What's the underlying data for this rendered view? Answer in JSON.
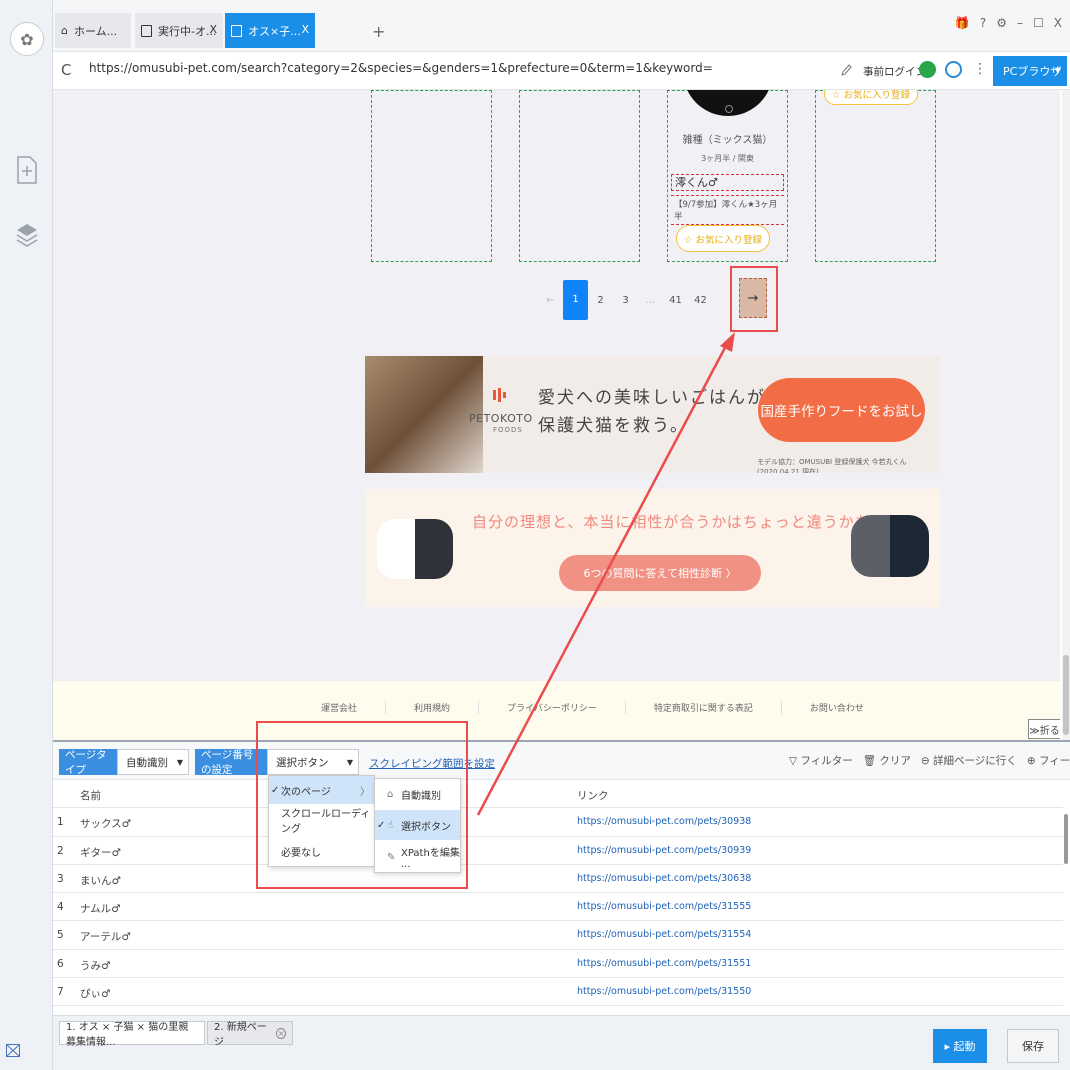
{
  "tabs": [
    {
      "label": "ホーム..."
    },
    {
      "label": "実行中-オ...",
      "close": "X"
    },
    {
      "label": "オス×子...",
      "close": "X"
    }
  ],
  "tab_add": "+",
  "window_controls": [
    "🎁",
    "?",
    "⚙",
    "–",
    "☐",
    "X"
  ],
  "address": {
    "reload": "C",
    "url": "https://omusubi-pet.com/search?category=2&species=&genders=1&prefecture=0&term=1&keyword=",
    "pre_login": "事前ログイン",
    "kebab": "⋮",
    "pc_browser": "PCブラウザ",
    "pc_caret": "▼"
  },
  "page": {
    "card": {
      "breed": "雑種（ミックス猫）",
      "age": "3ヶ月半 / 関東",
      "name": "澪くん♂",
      "note": "【9/7参加】澪くん★3ヶ月半",
      "fav": "☆ お気に入り登録"
    },
    "fav_partial": "☆ お気に入り登録",
    "pager": [
      "←",
      "1",
      "2",
      "3",
      "…",
      "41",
      "42"
    ],
    "pager_next": "→",
    "banner1": {
      "logo": "PETOKOTO",
      "logo_sub": "FOODS",
      "copy_line1": "愛犬への美味しいごはんが",
      "copy_line2": "保護犬猫を救う。",
      "cta": "国産手作りフードをお試し",
      "credit": "モデル協力：OMUSUBI 登録保護犬 今若丸くん (2020.04.21 現在)"
    },
    "banner2": {
      "title": "自分の理想と、本当に相性が合うかはちょっと違うかも。",
      "cta": "6つの質問に答えて相性診断 〉"
    },
    "footer_links": [
      "運営会社",
      "利用規約",
      "プライバシーポリシー",
      "特定商取引に関する表記",
      "お問い合わせ"
    ],
    "collapse": "≫折る"
  },
  "panel": {
    "page_type_label": "ページタイプ",
    "page_type_value": "自動識別",
    "page_num_label": "ページ番号の設定",
    "page_num_value": "選択ボタン",
    "scrape_range": "スクレイピング範囲を設定",
    "tools": [
      "▽ フィルター",
      "🗑 クリア",
      "⊖ 詳細ページに行く",
      "⊕ フィールドを追加"
    ],
    "columns": [
      "名前",
      "リンク"
    ],
    "rows": [
      {
        "idx": "1",
        "name": "サックス♂",
        "link": "https://omusubi-pet.com/pets/30938"
      },
      {
        "idx": "2",
        "name": "ギター♂",
        "link": "https://omusubi-pet.com/pets/30939"
      },
      {
        "idx": "3",
        "name": "まいん♂",
        "link": "https://omusubi-pet.com/pets/30638"
      },
      {
        "idx": "4",
        "name": "ナムル♂",
        "link": "https://omusubi-pet.com/pets/31555"
      },
      {
        "idx": "5",
        "name": "アーテル♂",
        "link": "https://omusubi-pet.com/pets/31554"
      },
      {
        "idx": "6",
        "name": "うみ♂",
        "link": "https://omusubi-pet.com/pets/31551"
      },
      {
        "idx": "7",
        "name": "ぴぃ♂",
        "link": "https://omusubi-pet.com/pets/31550"
      }
    ],
    "menu1": [
      {
        "label": "次のページ",
        "check": "✓",
        "sub": "〉"
      },
      {
        "label": "スクロールローディング"
      },
      {
        "label": "必要なし"
      }
    ],
    "menu2": [
      {
        "label": "自動識別",
        "icon": "⌂"
      },
      {
        "label": "選択ボタン",
        "check": "✓",
        "icon": "☝"
      },
      {
        "label": "XPathを編集 ...",
        "icon": "✎"
      }
    ]
  },
  "status": {
    "task1": "1. オス × 子猫 × 猫の里親募集情報...",
    "task2": "2. 新規ページ",
    "task2_close": "×",
    "run": "▸ 起動",
    "save": "保存"
  },
  "colors": {
    "accent": "#1b8fe8",
    "highlight_red": "#ea4c4c",
    "link": "#2062b6"
  }
}
